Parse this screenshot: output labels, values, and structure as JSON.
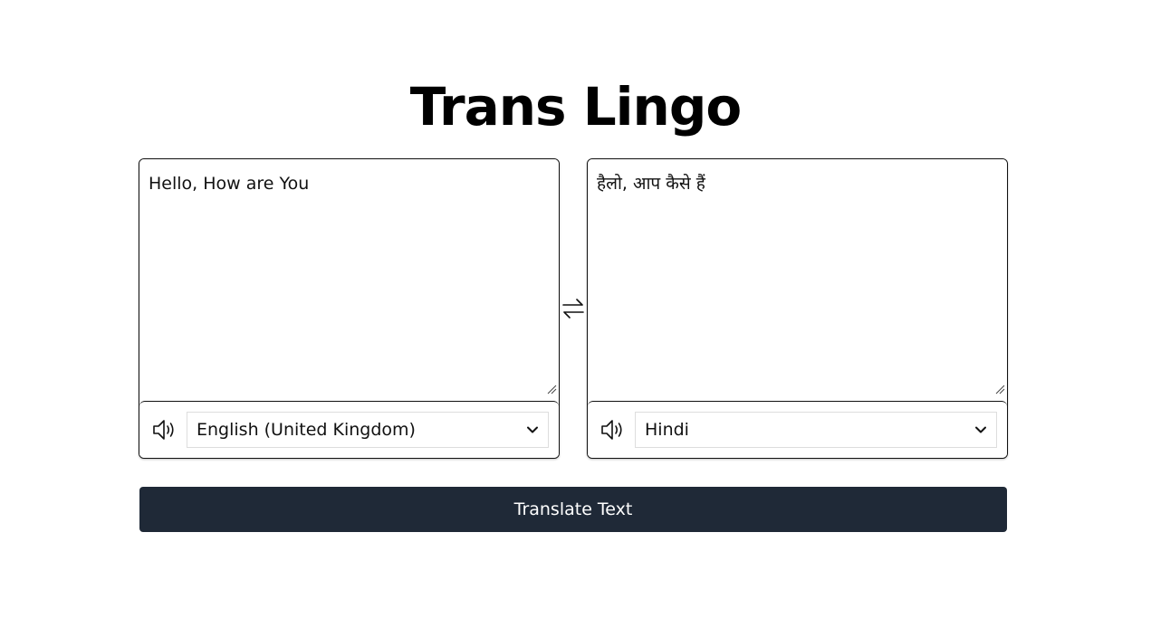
{
  "app": {
    "title": "Trans Lingo"
  },
  "source": {
    "text": "Hello, How are You",
    "language": "English (United Kingdom)",
    "speaker_icon": "speaker-icon"
  },
  "target": {
    "text": "हैलो, आप कैसे हैं",
    "language": "Hindi",
    "speaker_icon": "speaker-icon"
  },
  "swap": {
    "icon": "swap-arrows-icon"
  },
  "actions": {
    "translate_label": "Translate Text"
  },
  "colors": {
    "button_bg": "#1f2937",
    "button_text": "#ffffff",
    "border": "#111111"
  }
}
